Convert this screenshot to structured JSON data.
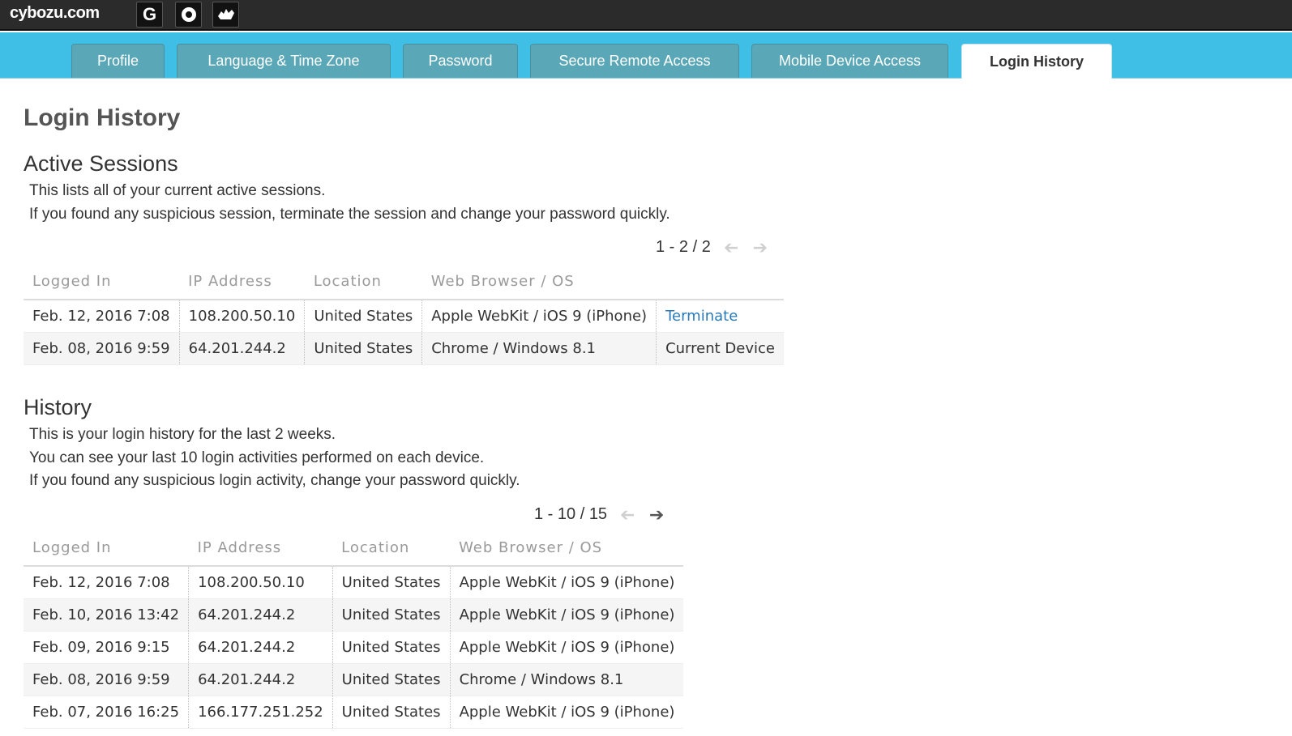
{
  "app": {
    "brand": "cybozu.com"
  },
  "apps": [
    {
      "label": "G"
    },
    {
      "label": ""
    },
    {
      "label": ""
    }
  ],
  "tabs": [
    {
      "label": "Profile"
    },
    {
      "label": "Language & Time Zone"
    },
    {
      "label": "Password"
    },
    {
      "label": "Secure Remote Access"
    },
    {
      "label": "Mobile Device Access"
    },
    {
      "label": "Login History"
    }
  ],
  "page": {
    "title": "Login History"
  },
  "active_sessions": {
    "title": "Active Sessions",
    "desc": [
      "This lists all of your current active sessions.",
      "If you found any suspicious session, terminate the session and change your password quickly."
    ],
    "pager": "1 - 2 / 2",
    "columns": [
      "Logged In",
      "IP Address",
      "Location",
      "Web Browser / OS",
      ""
    ],
    "rows": [
      [
        "Feb. 12, 2016 7:08",
        "108.200.50.10",
        "United States",
        "Apple WebKit / iOS 9 (iPhone)",
        "Terminate"
      ],
      [
        "Feb. 08, 2016 9:59",
        "64.201.244.2",
        "United States",
        "Chrome / Windows 8.1",
        "Current Device"
      ]
    ]
  },
  "history": {
    "title": "History",
    "desc": [
      "This is your login history for the last 2 weeks.",
      "You can see your last 10 login activities performed on each device.",
      "If you found any suspicious login activity, change your password quickly."
    ],
    "pager": "1 - 10 / 15",
    "columns": [
      "Logged In",
      "IP Address",
      "Location",
      "Web Browser / OS"
    ],
    "rows": [
      [
        "Feb. 12, 2016 7:08",
        "108.200.50.10",
        "United States",
        "Apple WebKit / iOS 9 (iPhone)"
      ],
      [
        "Feb. 10, 2016 13:42",
        "64.201.244.2",
        "United States",
        "Apple WebKit / iOS 9 (iPhone)"
      ],
      [
        "Feb. 09, 2016 9:15",
        "64.201.244.2",
        "United States",
        "Apple WebKit / iOS 9 (iPhone)"
      ],
      [
        "Feb. 08, 2016 9:59",
        "64.201.244.2",
        "United States",
        "Chrome / Windows 8.1"
      ],
      [
        "Feb. 07, 2016 16:25",
        "166.177.251.252",
        "United States",
        "Apple WebKit / iOS 9 (iPhone)"
      ]
    ]
  }
}
